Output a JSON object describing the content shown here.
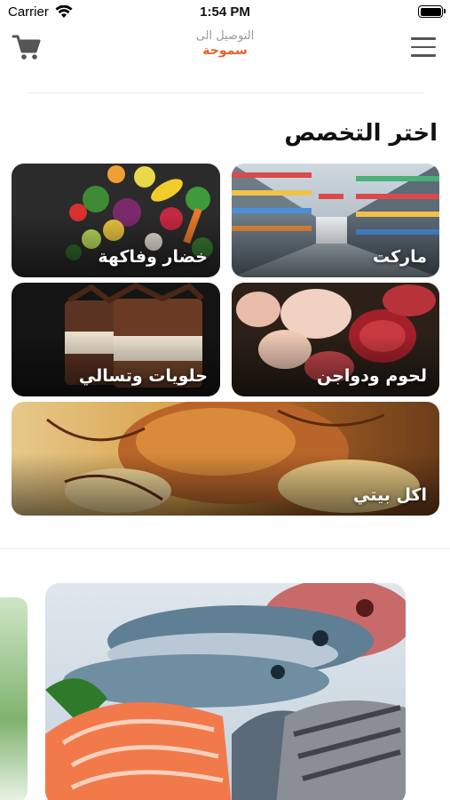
{
  "status_bar": {
    "carrier": "Carrier",
    "time": "1:54 PM"
  },
  "header": {
    "deliver_label": "التوصيل الى",
    "location": "سموحة",
    "icons": {
      "cart": "cart-icon",
      "menu": "menu-icon"
    },
    "accent_color": "#e8622c"
  },
  "section": {
    "title": "اختر التخصص"
  },
  "categories": [
    {
      "label": "ماركت"
    },
    {
      "label": "خضار وفاكهة"
    },
    {
      "label": "لحوم ودواجن"
    },
    {
      "label": "حلويات وتسالي"
    },
    {
      "label": "اكل بيتي"
    }
  ]
}
